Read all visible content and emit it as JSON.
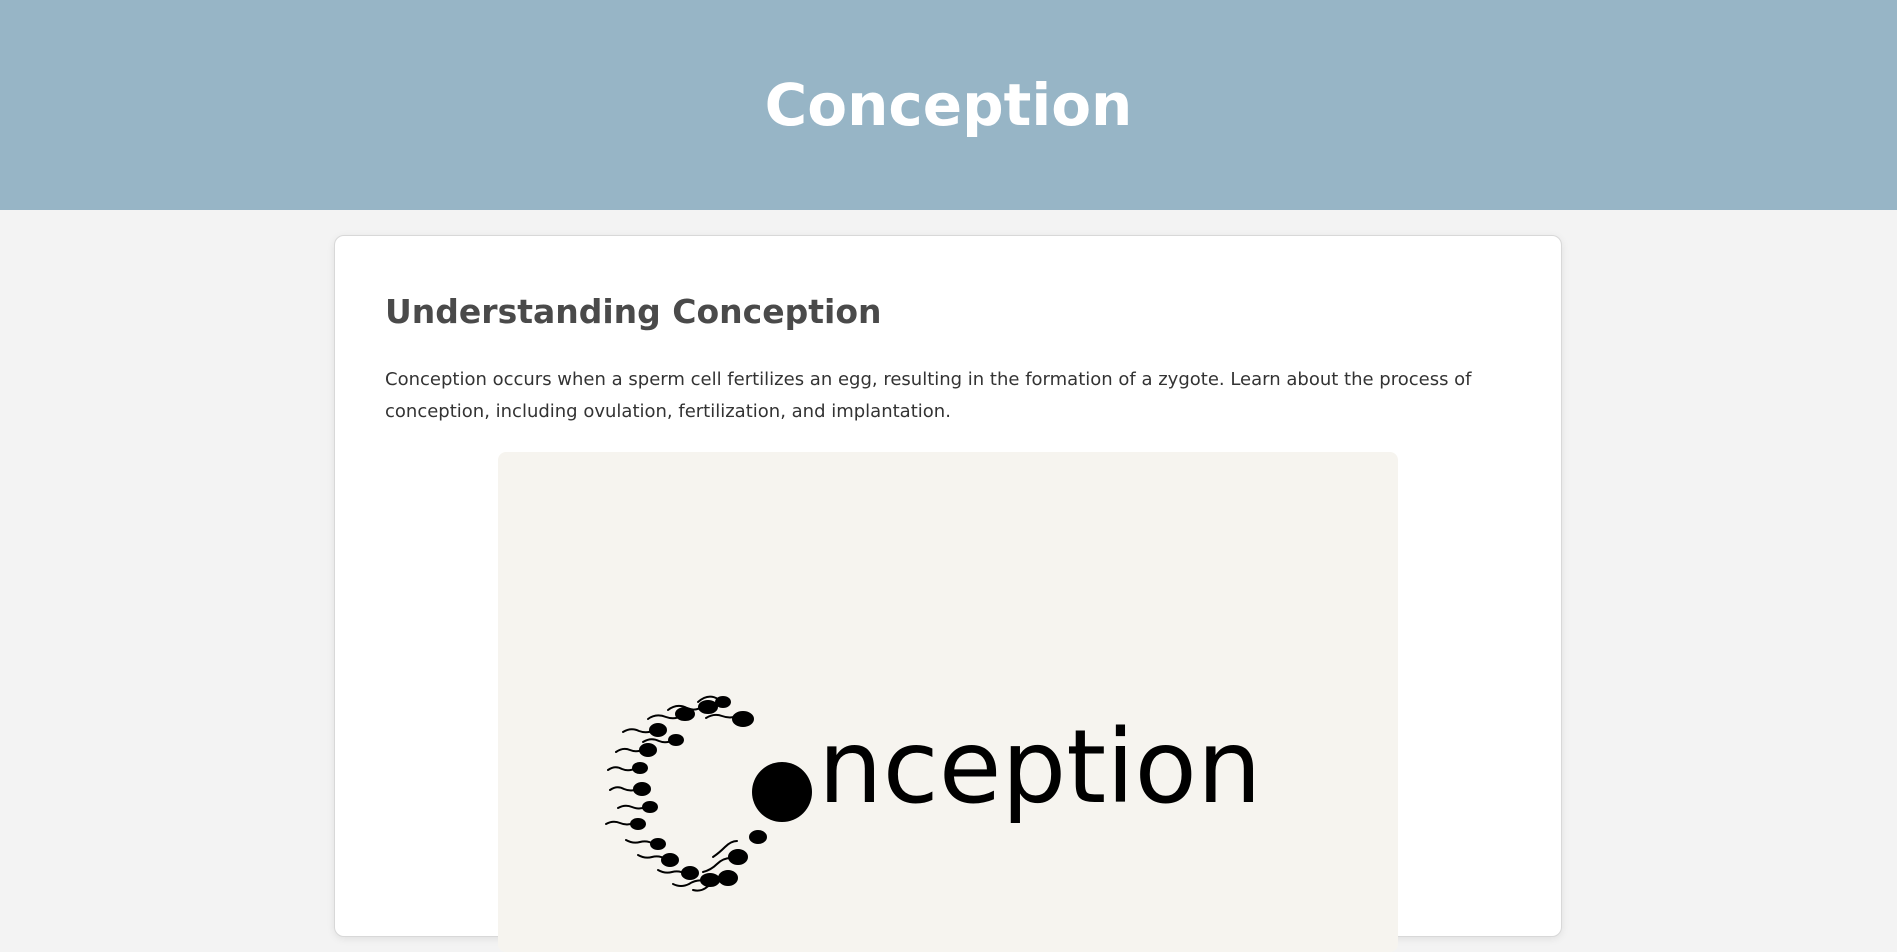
{
  "header": {
    "title": "Conception"
  },
  "article": {
    "heading": "Understanding Conception",
    "paragraph": "Conception occurs when a sperm cell fertilizes an egg, resulting in the formation of a zygote. Learn about the process of conception, including ovulation, fertilization, and implantation."
  },
  "image": {
    "logo_text": "nception",
    "background_color": "#f6f4ef"
  },
  "colors": {
    "header_bg": "#97b5c6",
    "page_bg": "#f3f3f3",
    "heading_text": "#4a4a4a"
  }
}
